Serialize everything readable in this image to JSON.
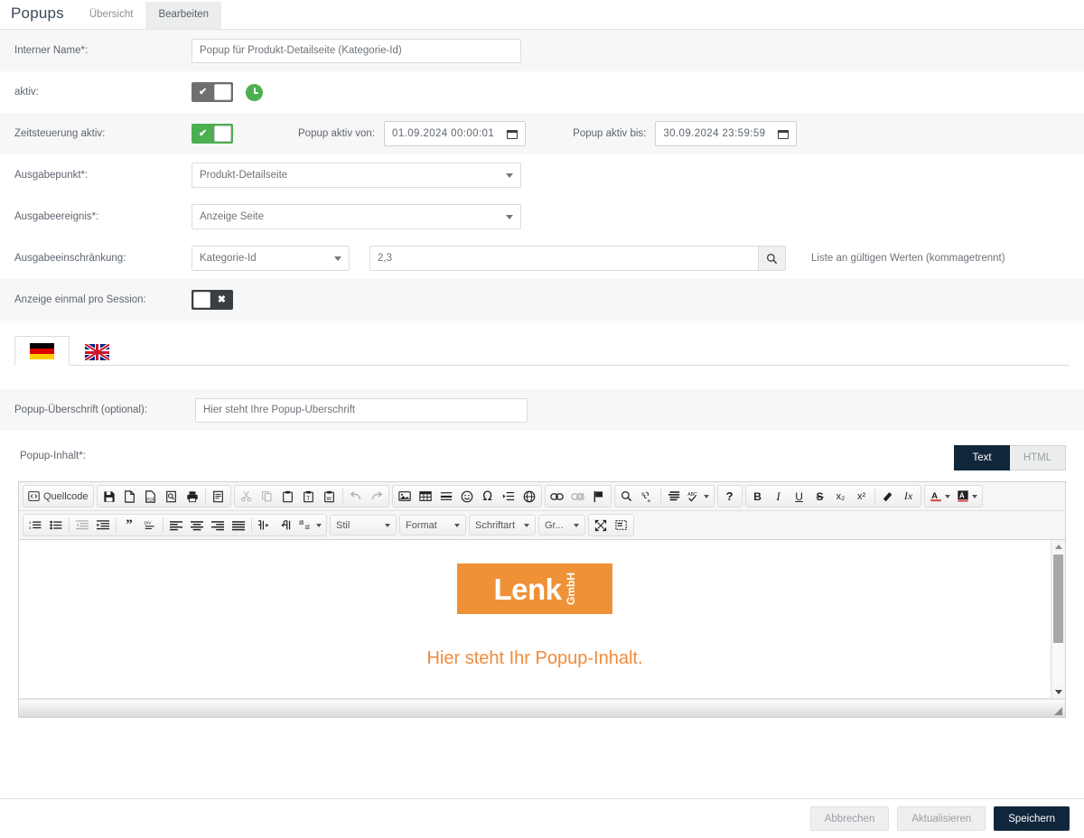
{
  "header": {
    "title": "Popups",
    "tabs": [
      {
        "label": "Übersicht",
        "active": false
      },
      {
        "label": "Bearbeiten",
        "active": true
      }
    ]
  },
  "form": {
    "internal_name": {
      "label": "Interner Name*:",
      "value": "Popup für Produkt-Detailseite (Kategorie-Id)"
    },
    "active": {
      "label": "aktiv:",
      "toggle_state": "on",
      "toggle_mark": "✔",
      "clock_icon": "clock-icon"
    },
    "time_control": {
      "label": "Zeitsteuerung aktiv:",
      "toggle_state": "on",
      "toggle_mark": "✔",
      "from_label": "Popup aktiv von:",
      "from_value": "01.09.2024 00:00:01",
      "to_label": "Popup aktiv bis:",
      "to_value": "30.09.2024 23:59:59"
    },
    "output_point": {
      "label": "Ausgabepunkt*:",
      "value": "Produkt-Detailseite"
    },
    "output_event": {
      "label": "Ausgabeereignis*:",
      "value": "Anzeige Seite"
    },
    "output_restriction": {
      "label": "Ausgabeeinschränkung:",
      "select_value": "Kategorie-Id",
      "input_value": "2,3",
      "search_icon": "search-icon",
      "hint": "Liste an gültigen Werten (kommagetrennt)"
    },
    "once_per_session": {
      "label": "Anzeige einmal pro Session:",
      "toggle_state": "off",
      "toggle_mark": "✖"
    }
  },
  "language_tabs": [
    {
      "name": "flag-de-icon",
      "title": "Deutsch",
      "active": true
    },
    {
      "name": "flag-gb-icon",
      "title": "English",
      "active": false
    }
  ],
  "content": {
    "headline_field": {
      "label": "Popup-Überschrift (optional):",
      "value": "Hier steht Ihre Popup-Überschrift"
    },
    "body_label": "Popup-Inhalt*:",
    "mode_buttons": [
      {
        "label": "Text",
        "active": true
      },
      {
        "label": "HTML",
        "active": false
      }
    ]
  },
  "editor": {
    "toolbar_row1": [
      {
        "group": 1,
        "items": [
          {
            "name": "source-code-button",
            "label": "Quellcode",
            "icon": "source-icon"
          }
        ]
      },
      {
        "group": 2,
        "items": [
          {
            "name": "save-button",
            "icon": "floppy-icon"
          },
          {
            "name": "new-page-button",
            "icon": "page-icon"
          },
          {
            "name": "export-pdf-button",
            "icon": "pdf-icon"
          },
          {
            "name": "preview-button",
            "icon": "preview-icon"
          },
          {
            "name": "print-button",
            "icon": "printer-icon"
          },
          {
            "name": "templates-button",
            "icon": "templates-icon"
          }
        ]
      },
      {
        "group": 3,
        "items": [
          {
            "name": "cut-button",
            "icon": "scissors-icon",
            "disabled": true
          },
          {
            "name": "copy-button",
            "icon": "copy-icon",
            "disabled": true
          },
          {
            "name": "paste-button",
            "icon": "clipboard-icon"
          },
          {
            "name": "paste-text-button",
            "icon": "clipboard-text-icon"
          },
          {
            "name": "paste-word-button",
            "icon": "clipboard-word-icon"
          },
          {
            "name": "undo-button",
            "icon": "undo-icon",
            "disabled": true
          },
          {
            "name": "redo-button",
            "icon": "redo-icon",
            "disabled": true
          }
        ]
      },
      {
        "group": 4,
        "items": [
          {
            "name": "image-button",
            "icon": "image-icon"
          },
          {
            "name": "table-button",
            "icon": "table-icon"
          },
          {
            "name": "horizontal-rule-button",
            "icon": "hrule-icon"
          },
          {
            "name": "smiley-button",
            "icon": "smiley-icon"
          },
          {
            "name": "special-char-button",
            "icon": "omega-icon"
          },
          {
            "name": "page-break-button",
            "icon": "pagebreak-icon"
          },
          {
            "name": "iframe-button",
            "icon": "globe-icon"
          }
        ]
      },
      {
        "group": 5,
        "items": [
          {
            "name": "link-button",
            "icon": "link-icon"
          },
          {
            "name": "unlink-button",
            "icon": "unlink-icon",
            "disabled": true
          },
          {
            "name": "anchor-button",
            "icon": "flag-icon"
          }
        ]
      },
      {
        "group": 6,
        "items": [
          {
            "name": "find-button",
            "icon": "magnifier-icon"
          },
          {
            "name": "replace-button",
            "icon": "replace-icon"
          },
          {
            "name": "select-all-button",
            "icon": "select-all-icon"
          },
          {
            "name": "spellcheck-button",
            "icon": "spellcheck-icon"
          }
        ]
      },
      {
        "group": 7,
        "items": [
          {
            "name": "help-button",
            "icon": "question-icon",
            "label": "?"
          }
        ]
      },
      {
        "group": 8,
        "items": [
          {
            "name": "bold-button",
            "label": "B"
          },
          {
            "name": "italic-button",
            "label": "I"
          },
          {
            "name": "underline-button",
            "label": "U"
          },
          {
            "name": "strike-button",
            "label": "S"
          },
          {
            "name": "subscript-button",
            "label": "x₂"
          },
          {
            "name": "superscript-button",
            "label": "x²"
          },
          {
            "name": "remove-format-button",
            "icon": "brush-icon"
          },
          {
            "name": "clear-format-button",
            "label": "Ix"
          }
        ]
      },
      {
        "group": 9,
        "items": [
          {
            "name": "text-color-button",
            "label": "A",
            "icon": "text-color-icon"
          },
          {
            "name": "background-color-button",
            "label": "A",
            "icon": "bg-color-icon"
          }
        ]
      }
    ],
    "toolbar_row2": [
      {
        "group": 1,
        "items": [
          {
            "name": "numbered-list-button",
            "icon": "ol-icon"
          },
          {
            "name": "bulleted-list-button",
            "icon": "ul-icon"
          },
          {
            "name": "outdent-button",
            "icon": "outdent-icon",
            "disabled": true
          },
          {
            "name": "indent-button",
            "icon": "indent-icon"
          },
          {
            "name": "blockquote-button",
            "icon": "quote-icon"
          },
          {
            "name": "div-container-button",
            "icon": "div-icon"
          },
          {
            "name": "align-left-button",
            "icon": "align-left-icon"
          },
          {
            "name": "align-center-button",
            "icon": "align-center-icon"
          },
          {
            "name": "align-right-button",
            "icon": "align-right-icon"
          },
          {
            "name": "align-justify-button",
            "icon": "align-justify-icon"
          },
          {
            "name": "ltr-button",
            "icon": "ltr-icon"
          },
          {
            "name": "rtl-button",
            "icon": "rtl-icon"
          },
          {
            "name": "language-button",
            "icon": "language-icon"
          }
        ]
      }
    ],
    "dropdowns": [
      {
        "name": "style-dropdown",
        "label": "Stil"
      },
      {
        "name": "format-dropdown",
        "label": "Format"
      },
      {
        "name": "font-dropdown",
        "label": "Schriftart"
      },
      {
        "name": "size-dropdown",
        "label": "Gr..."
      }
    ],
    "extra_buttons": [
      {
        "name": "maximize-button",
        "icon": "maximize-icon"
      },
      {
        "name": "show-blocks-button",
        "icon": "show-blocks-icon"
      }
    ],
    "body": {
      "logo_main": "Lenk",
      "logo_sub": "GmbH",
      "logo_color": "#ef9237",
      "paragraph": "Hier steht Ihr Popup-Inhalt.",
      "paragraph_color": "#f08a3c"
    }
  },
  "footer": {
    "buttons": [
      {
        "name": "cancel-button",
        "label": "Abbrechen",
        "primary": false
      },
      {
        "name": "update-button",
        "label": "Aktualisieren",
        "primary": false
      },
      {
        "name": "save-button",
        "label": "Speichern",
        "primary": true
      }
    ]
  }
}
